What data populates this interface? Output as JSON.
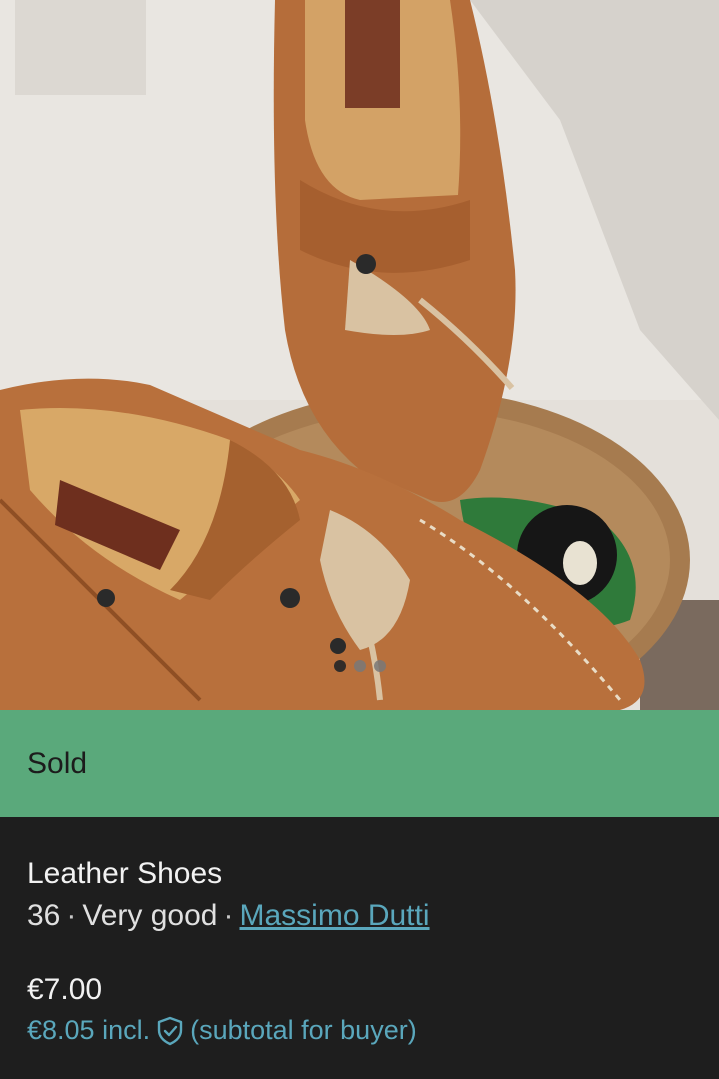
{
  "listing": {
    "status": "Sold",
    "title": "Leather Shoes",
    "size": "36",
    "condition": "Very good",
    "brand": "Massimo Dutti",
    "separator": "·",
    "price": "€7.00",
    "price_incl": "€8.05 incl.",
    "subtotal_note": "(subtotal for buyer)"
  },
  "gallery": {
    "photo_count": 3,
    "active_index": 0
  },
  "colors": {
    "sold_bar": "#5aa97b",
    "accent_link": "#5aa7bc",
    "background": "#1e1e1e"
  },
  "icons": {
    "buyer_protection": "shield-check-icon"
  }
}
